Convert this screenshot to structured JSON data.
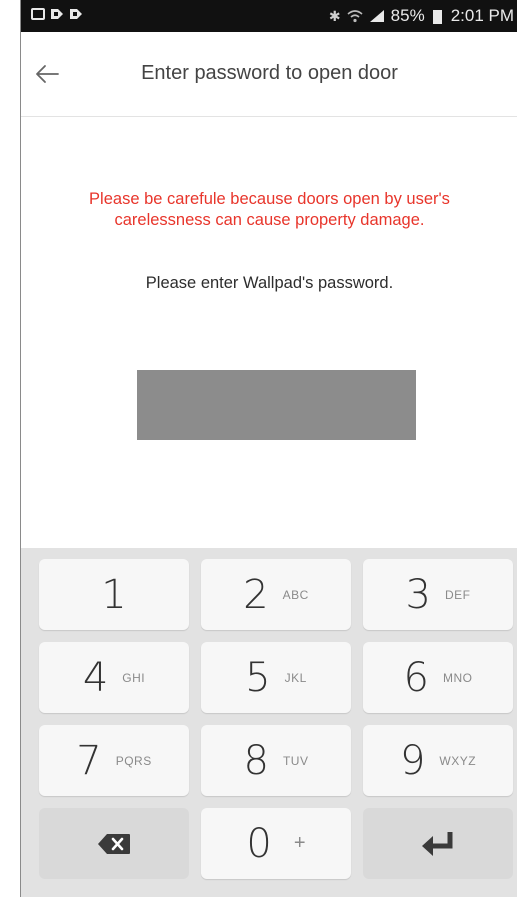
{
  "status_bar": {
    "battery": "85%",
    "time": "2:01 PM",
    "icons": [
      "notification-icon",
      "notification-icon",
      "notification-icon",
      "bluetooth-icon",
      "wifi-icon",
      "signal-icon",
      "battery-icon"
    ]
  },
  "header": {
    "title": "Enter password to open door",
    "back_icon": "arrow-left-icon"
  },
  "body": {
    "warning": "Please be carefule because doors open by user's carelessness can cause property damage.",
    "instruction": "Please enter Wallpad's password.",
    "colors": {
      "warning": "#e8352b",
      "password_box": "#8c8c8c"
    }
  },
  "keypad": {
    "keys": [
      {
        "digit": "1",
        "letters": ""
      },
      {
        "digit": "2",
        "letters": "ABC"
      },
      {
        "digit": "3",
        "letters": "DEF"
      },
      {
        "digit": "4",
        "letters": "GHI"
      },
      {
        "digit": "5",
        "letters": "JKL"
      },
      {
        "digit": "6",
        "letters": "MNO"
      },
      {
        "digit": "7",
        "letters": "PQRS"
      },
      {
        "digit": "8",
        "letters": "TUV"
      },
      {
        "digit": "9",
        "letters": "WXYZ"
      },
      {
        "digit": "0",
        "letters": "+"
      }
    ],
    "backspace_icon": "backspace-icon",
    "enter_icon": "enter-icon"
  }
}
